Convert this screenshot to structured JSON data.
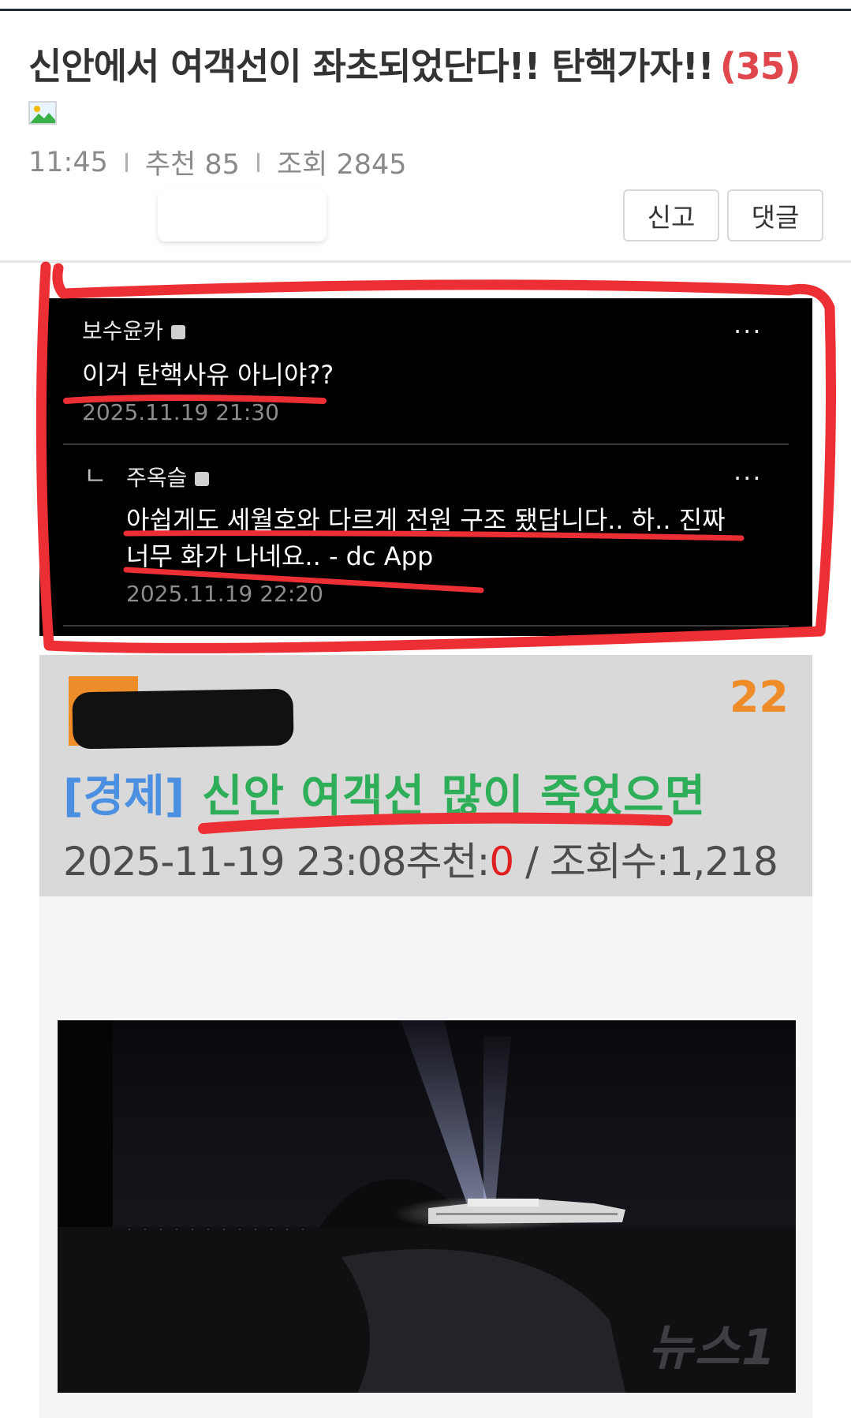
{
  "post": {
    "title": "신안에서 여객선이 좌초되었단다!! 탄핵가자!!",
    "comment_count": "(35)",
    "time": "11:45",
    "recommend": "추천 85",
    "views": "조회 2845"
  },
  "actions": {
    "report_label": "신고",
    "comment_label": "댓글"
  },
  "capture_comments": {
    "comment": {
      "author": "보수윤카",
      "text": "이거 탄핵사유 아니야??",
      "date": "2025.11.19 21:30"
    },
    "reply": {
      "mark": "ㄴ",
      "author": "주옥슬",
      "line1": "아쉽게도 세월호와 다르게 전원 구조 됐답니다.. 하.. 진짜",
      "line2": "너무 화가 나네요.. - dc App",
      "date": "2025.11.19 22:20"
    },
    "more": "..."
  },
  "capture_post": {
    "number": "22",
    "category": "[경제]",
    "title": "신안 여객선 많이 죽었으면",
    "date": "2025-11-19 23:08",
    "recommend_label": "추천:",
    "recommend_value": "0",
    "views": " / 조회수:1,218"
  },
  "photo": {
    "watermark": "뉴스1"
  },
  "colors": {
    "title": "#333333",
    "count": "#e0474c",
    "annotation": "#ec2f35",
    "category": "#4a8fe0",
    "post_title": "#2eae58",
    "number": "#ee8c2a"
  }
}
